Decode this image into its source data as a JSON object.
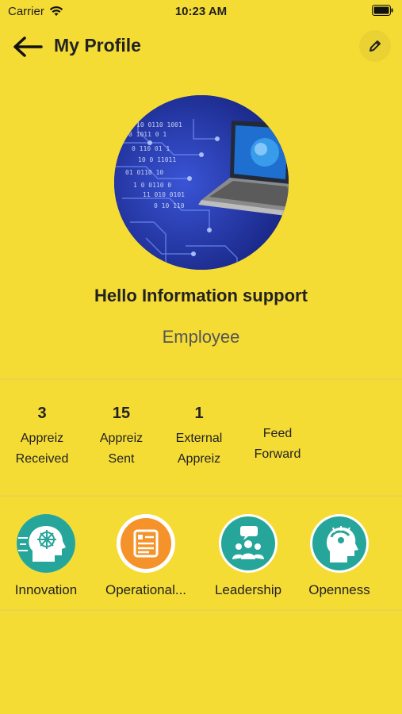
{
  "status_bar": {
    "carrier": "Carrier",
    "time": "10:23 AM",
    "icons": [
      "wifi-icon",
      "battery-icon"
    ]
  },
  "header": {
    "title": "My Profile",
    "back_icon": "arrow-left-icon",
    "edit_icon": "pencil-icon"
  },
  "profile": {
    "greeting": "Hello Information support",
    "role": "Employee"
  },
  "stats": [
    {
      "value": "3",
      "label_line1": "Appreiz",
      "label_line2": "Received"
    },
    {
      "value": "15",
      "label_line1": "Appreiz",
      "label_line2": "Sent"
    },
    {
      "value": "1",
      "label_line1": "External",
      "label_line2": "Appreiz"
    },
    {
      "value": "",
      "label_line1": "Feed",
      "label_line2": "Forward"
    }
  ],
  "values": [
    {
      "label": "Innovation",
      "icon": "brain-network-icon"
    },
    {
      "label": "Operational...",
      "icon": "document-list-icon"
    },
    {
      "label": "Leadership",
      "icon": "team-speech-icon"
    },
    {
      "label": "Openness",
      "icon": "open-mind-icon"
    }
  ],
  "colors": {
    "background": "#f5dc35",
    "divider": "#e9d44a",
    "teal": "#26a69a",
    "orange": "#f5932a"
  }
}
